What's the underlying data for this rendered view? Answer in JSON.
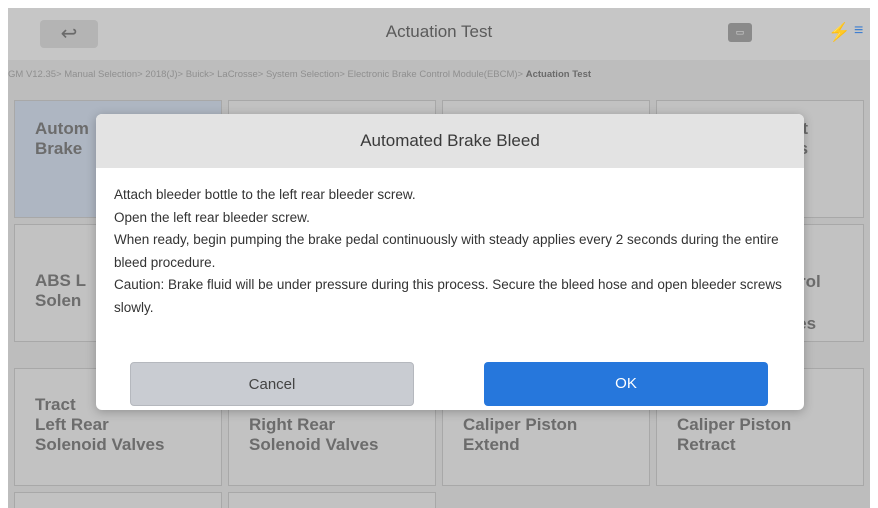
{
  "header": {
    "back_icon": "↩",
    "title": "Actuation Test",
    "message_icon": "▭"
  },
  "breadcrumb": {
    "path": "GM V12.35> Manual Selection> 2018(J)> Buick> LaCrosse> System Selection> Electronic Brake Control Module(EBCM)> ",
    "current": "Actuation Test"
  },
  "tiles": [
    {
      "line1": "Autom",
      "line2": "Brake"
    },
    {
      "line1": "",
      "line2": ""
    },
    {
      "line1": "",
      "line2": ""
    },
    {
      "line1": "ront",
      "line2": "lves"
    },
    {
      "line1": "ABS L",
      "line2": "Solen"
    },
    {
      "line1": "",
      "line2": ""
    },
    {
      "line1": "",
      "line2": ""
    },
    {
      "line1": "ntrol",
      "line2": "lves"
    },
    {
      "line1": "Tract",
      "line2": "Left Rear",
      "line3": "Solenoid Valves"
    },
    {
      "line1": "Right Rear",
      "line2": "Solenoid Valves"
    },
    {
      "line1": "Caliper Piston",
      "line2": "Extend"
    },
    {
      "line1": "Caliper Piston",
      "line2": "Retract"
    }
  ],
  "dialog": {
    "title": "Automated Brake Bleed",
    "lines": [
      "Attach bleeder bottle to the left rear bleeder screw.",
      "Open the left rear bleeder screw.",
      "When ready, begin pumping the brake pedal continuously with steady applies every 2 seconds during the entire bleed procedure.",
      "Caution: Brake fluid will be under pressure during this process. Secure the bleed hose and open bleeder screws slowly."
    ],
    "cancel_label": "Cancel",
    "ok_label": "OK"
  }
}
